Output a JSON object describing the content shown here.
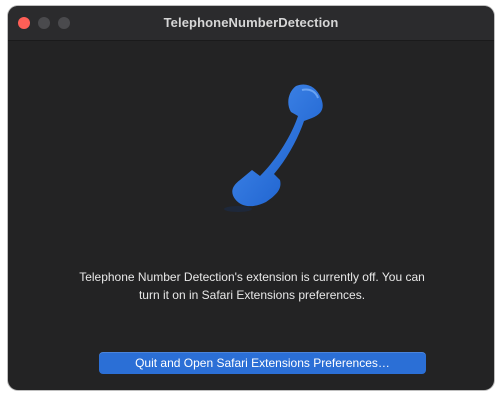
{
  "window": {
    "title": "TelephoneNumberDetection"
  },
  "content": {
    "icon": "telephone-handset-icon",
    "message_line1": "Telephone Number Detection's extension is currently off. You can",
    "message_line2": "turn it on in Safari Extensions preferences.",
    "button_label": "Quit and Open Safari Extensions Preferences…"
  },
  "colors": {
    "window_background": "#232324",
    "accent": "#2b6fd6",
    "close_button": "#ff5f57",
    "icon_blue": "#1f6fe0"
  }
}
